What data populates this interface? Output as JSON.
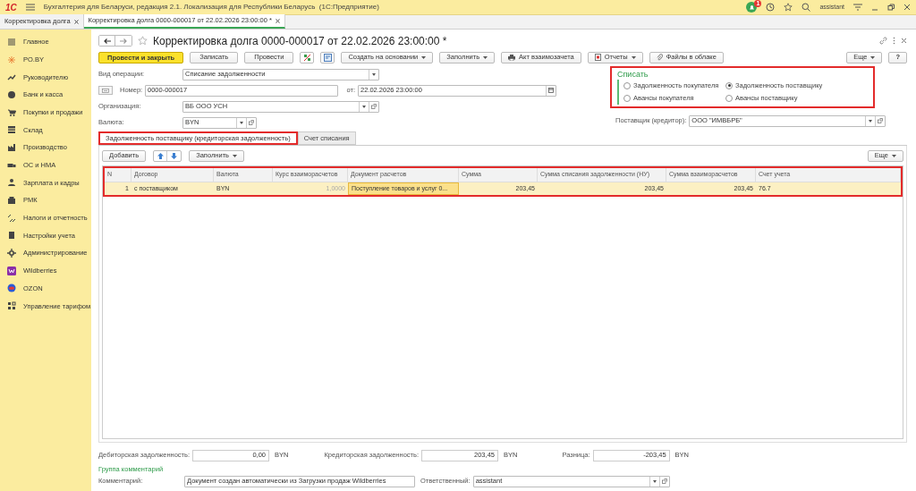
{
  "app_bar": {
    "logo": "1С",
    "title": "Бухгалтерия для Беларуси, редакция 2.1. Локализация для Республики Беларусь  (1С:Предприятие)",
    "notification_count": "1",
    "user": "assistant"
  },
  "open_tabs": [
    {
      "label": "Корректировка долга",
      "selected": false
    },
    {
      "label": "Корректировка долга 0000-000017 от 22.02.2026 23:00:00 *",
      "selected": true
    }
  ],
  "sidebar": {
    "items": [
      {
        "label": "Главное"
      },
      {
        "label": "PO.BY"
      },
      {
        "label": "Руководителю"
      },
      {
        "label": "Банк и касса"
      },
      {
        "label": "Покупки и продажи"
      },
      {
        "label": "Склад"
      },
      {
        "label": "Производство"
      },
      {
        "label": "ОС и НМА"
      },
      {
        "label": "Зарплата и кадры"
      },
      {
        "label": "РМК"
      },
      {
        "label": "Налоги и отчетность"
      },
      {
        "label": "Настройки учета"
      },
      {
        "label": "Администрирование"
      },
      {
        "label": "Wildberries"
      },
      {
        "label": "OZON"
      },
      {
        "label": "Управление тарифом"
      }
    ]
  },
  "document": {
    "title": "Корректировка долга 0000-000017 от 22.02.2026 23:00:00 *",
    "toolbar": [
      {
        "kind": "primary",
        "label": "Провести и закрыть"
      },
      {
        "kind": "plain",
        "label": "Записать"
      },
      {
        "kind": "plain",
        "label": "Провести"
      },
      {
        "kind": "dtkt"
      },
      {
        "kind": "structure"
      },
      {
        "kind": "menu",
        "label": "Создать на основании"
      },
      {
        "kind": "menu",
        "label": "Заполнить"
      },
      {
        "kind": "print",
        "label": "Акт взаимозачета"
      },
      {
        "kind": "report",
        "label": "Отчеты"
      },
      {
        "kind": "attach",
        "label": "Файлы в облаке"
      }
    ],
    "more_button": "Еще",
    "help_button": "?",
    "operation": {
      "label": "Вид операции:",
      "value": "Списание задолженности"
    },
    "number": {
      "label": "Номер:",
      "value": "0000-000017"
    },
    "date": {
      "label": "от:",
      "value": "22.02.2026 23:00:00"
    },
    "organization": {
      "label": "Организация:",
      "value": "ВБ ООО УСН"
    },
    "currency": {
      "label": "Валюта:",
      "value": "BYN"
    },
    "write_off": {
      "title": "Списать",
      "options": [
        {
          "label": "Задолженность покупателя",
          "selected": false
        },
        {
          "label": "Задолженность поставщику",
          "selected": true
        },
        {
          "label": "Авансы покупателя",
          "selected": false
        },
        {
          "label": "Авансы поставщику",
          "selected": false
        }
      ]
    },
    "supplier": {
      "label": "Поставщик (кредитор):",
      "value": "ООО \"ИМВБРБ\""
    },
    "form_tabs": [
      {
        "label": "Задолженность поставщику (кредиторская задолженность)",
        "selected": true
      },
      {
        "label": "Счет списания",
        "selected": false
      }
    ],
    "table_toolbar": {
      "add": "Добавить",
      "fill": "Заполнить",
      "more": "Еще"
    },
    "table": {
      "columns": [
        "N",
        "Договор",
        "Валюта",
        "Курс взаиморасчетов",
        "Документ расчетов",
        "Сумма",
        "Сумма списания задолженности (НУ)",
        "Сумма взаиморасчетов",
        "Счет учета"
      ],
      "rows": [
        {
          "selected": true,
          "cells": [
            "1",
            "с поставщиком",
            "BYN",
            "1,0000",
            "Поступление товаров и услуг 0...",
            "203,45",
            "203,45",
            "203,45",
            "76.7"
          ]
        }
      ]
    },
    "totals": [
      {
        "label": "Дебиторская задолженность:",
        "value": "0,00",
        "unit": "BYN"
      },
      {
        "label": "Кредиторская задолженность:",
        "value": "203,45",
        "unit": "BYN"
      },
      {
        "label": "Разница:",
        "value": "-203,45",
        "unit": "BYN"
      }
    ],
    "comment_group": "Группа комментарий",
    "comment": {
      "label": "Комментарий:",
      "value": "Документ создан автоматически из Загрузки продаж Wildberries"
    },
    "responsible": {
      "label": "Ответственный:",
      "value": "assistant"
    }
  }
}
